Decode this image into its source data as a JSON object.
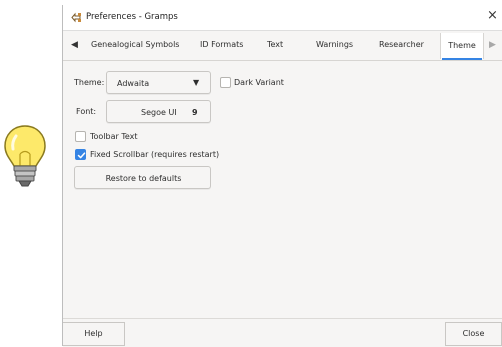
{
  "window": {
    "title": "Preferences - Gramps",
    "close_glyph": "×"
  },
  "tabs": {
    "left_arrow": "◀",
    "right_arrow": "▶",
    "items": [
      {
        "label": "Genealogical Symbols"
      },
      {
        "label": "ID Formats"
      },
      {
        "label": "Text"
      },
      {
        "label": "Warnings"
      },
      {
        "label": "Researcher"
      },
      {
        "label": "Theme",
        "active": true
      }
    ]
  },
  "theme_section": {
    "theme_label": "Theme:",
    "theme_value": "Adwaita",
    "combo_arrow": "▼",
    "dark_variant_label": "Dark Variant",
    "dark_variant_checked": false,
    "font_label": "Font:",
    "font_name": "Segoe UI",
    "font_size": "9",
    "toolbar_text_label": "Toolbar Text",
    "toolbar_text_checked": false,
    "fixed_scrollbar_label": "Fixed Scrollbar (requires restart)",
    "fixed_scrollbar_checked": true,
    "restore_label": "Restore to defaults"
  },
  "footer": {
    "help_label": "Help",
    "close_label": "Close"
  },
  "colors": {
    "accent": "#3584e4",
    "background": "#f6f5f4",
    "bulb_glass": "#fde96a"
  },
  "icons": [
    "lightbulb-icon",
    "gramps-app-icon",
    "close-icon",
    "chevron-left-icon",
    "chevron-right-icon",
    "dropdown-arrow-icon",
    "checkmark-icon"
  ]
}
